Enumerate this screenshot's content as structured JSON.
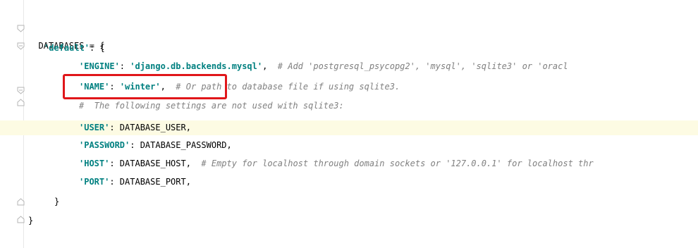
{
  "editor": {
    "lines": [
      {
        "id": "l1",
        "indent": 0,
        "text": "DATABASES = {"
      },
      {
        "id": "l2",
        "indent": 1,
        "key": "'default'",
        "rest": ": {"
      },
      {
        "id": "l3",
        "indent": 2,
        "key": "'ENGINE'",
        "sep": ": ",
        "value": "'django.db.backends.mysql'",
        "rest": ",  ",
        "comment": "# Add 'postgresql_psycopg2', 'mysql', 'sqlite3' or 'oracl"
      },
      {
        "id": "l4",
        "indent": 2,
        "key": "'NAME'",
        "sep": ": ",
        "value": "'winter'",
        "rest": ",  ",
        "comment": "# Or path to database file if using sqlite3."
      },
      {
        "id": "l5",
        "indent": 2,
        "comment": "#  The following settings are not used with sqlite3:"
      },
      {
        "id": "l6",
        "indent": 2,
        "key": "'USER'",
        "rest": ": DATABASE_USER,"
      },
      {
        "id": "l7",
        "indent": 2,
        "key": "'PASSWORD'",
        "rest": ": DATABASE_PASSWORD,"
      },
      {
        "id": "l8",
        "indent": 2,
        "key": "'HOST'",
        "rest": ": DATABASE_HOST,  ",
        "comment": "# Empty for localhost through domain sockets or '127.0.0.1' for localhost thr"
      },
      {
        "id": "l9",
        "indent": 2,
        "key": "'PORT'",
        "rest": ": DATABASE_PORT,"
      },
      {
        "id": "l10",
        "indent": 1,
        "text": "}"
      },
      {
        "id": "l11",
        "indent": 0,
        "text": "}"
      }
    ]
  },
  "colors": {
    "keyword": "#008080",
    "comment": "#808080",
    "caret_row": "#fdfbe3",
    "highlight_border": "#e0161a"
  }
}
